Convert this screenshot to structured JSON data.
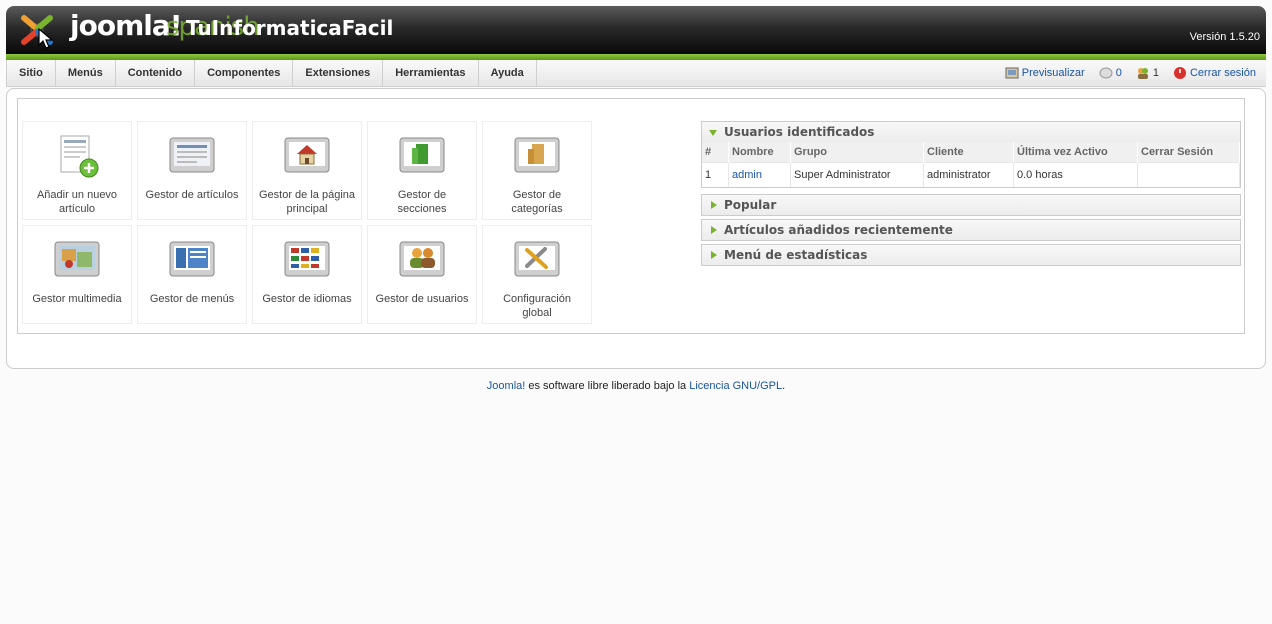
{
  "header": {
    "logo_text": "joomla!",
    "logo_sub": "spanish",
    "site_name": "TuInformaticaFacil",
    "version": "Versión 1.5.20"
  },
  "menu": [
    "Sitio",
    "Menús",
    "Contenido",
    "Componentes",
    "Extensiones",
    "Herramientas",
    "Ayuda"
  ],
  "status": {
    "preview": "Previsualizar",
    "messages": "0",
    "users_online": "1",
    "logout": "Cerrar sesión"
  },
  "quickicons": [
    {
      "label": "Añadir un nuevo artículo",
      "icon": "add-article-icon"
    },
    {
      "label": "Gestor de artículos",
      "icon": "article-manager-icon"
    },
    {
      "label": "Gestor de la página principal",
      "icon": "frontpage-icon"
    },
    {
      "label": "Gestor de secciones",
      "icon": "section-icon"
    },
    {
      "label": "Gestor de categorías",
      "icon": "category-icon"
    },
    {
      "label": "Gestor multimedia",
      "icon": "media-icon"
    },
    {
      "label": "Gestor de menús",
      "icon": "menu-icon"
    },
    {
      "label": "Gestor de idiomas",
      "icon": "language-icon"
    },
    {
      "label": "Gestor de usuarios",
      "icon": "user-icon"
    },
    {
      "label": "Configuración global",
      "icon": "config-icon"
    }
  ],
  "panels": {
    "logged_users": {
      "title": "Usuarios identificados",
      "columns": [
        "#",
        "Nombre",
        "Grupo",
        "Cliente",
        "Última vez Activo",
        "Cerrar Sesión"
      ],
      "rows": [
        {
          "num": "1",
          "name": "admin",
          "group": "Super Administrator",
          "client": "administrator",
          "last_active": "0.0 horas",
          "logout": ""
        }
      ]
    },
    "popular": "Popular",
    "recent": "Artículos añadidos recientemente",
    "stats": "Menú de estadísticas"
  },
  "footer": {
    "joomla_link": "Joomla!",
    "text": " es software libre liberado bajo la ",
    "license_link": "Licencia GNU/GPL",
    "end": "."
  },
  "colors": {
    "accent_green": "#7ab32e",
    "link_blue": "#1a55a4"
  }
}
